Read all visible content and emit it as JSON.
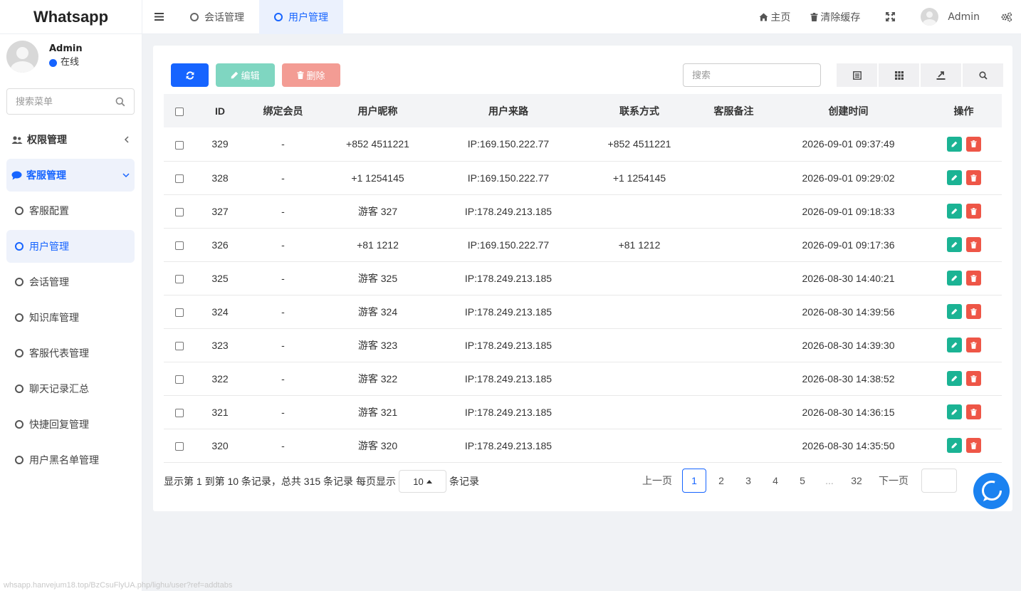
{
  "app": {
    "title": "Whatsapp"
  },
  "user": {
    "name": "Admin",
    "status": "在线"
  },
  "sidebar": {
    "search_placeholder": "搜索菜单",
    "groups": [
      {
        "label": "权限管理",
        "icon": "users-icon"
      },
      {
        "label": "客服管理",
        "icon": "comment-icon"
      }
    ],
    "items": [
      {
        "label": "客服配置"
      },
      {
        "label": "用户管理",
        "active": true
      },
      {
        "label": "会话管理"
      },
      {
        "label": "知识库管理"
      },
      {
        "label": "客服代表管理"
      },
      {
        "label": "聊天记录汇总"
      },
      {
        "label": "快捷回复管理"
      },
      {
        "label": "用户黑名单管理"
      }
    ]
  },
  "tabs": [
    {
      "label": "会话管理"
    },
    {
      "label": "用户管理",
      "active": true
    }
  ],
  "topbar": {
    "home": "主页",
    "clear_cache": "清除缓存",
    "user": "Admin"
  },
  "toolbar": {
    "edit": "编辑",
    "delete": "删除",
    "search_placeholder": "搜索"
  },
  "table": {
    "headers": [
      "ID",
      "绑定会员",
      "用户昵称",
      "用户来路",
      "联系方式",
      "客服备注",
      "创建时间",
      "操作"
    ],
    "rows": [
      {
        "id": "329",
        "member": "-",
        "nickname": "+852 4511221",
        "source": "IP:169.150.222.77",
        "contact": "+852 4511221",
        "note": "",
        "created": "2026-09-01 09:37:49"
      },
      {
        "id": "328",
        "member": "-",
        "nickname": "+1 1254145",
        "source": "IP:169.150.222.77",
        "contact": "+1 1254145",
        "note": "",
        "created": "2026-09-01 09:29:02"
      },
      {
        "id": "327",
        "member": "-",
        "nickname": "游客 327",
        "source": "IP:178.249.213.185",
        "contact": "",
        "note": "",
        "created": "2026-09-01 09:18:33"
      },
      {
        "id": "326",
        "member": "-",
        "nickname": "+81 1212",
        "source": "IP:169.150.222.77",
        "contact": "+81 1212",
        "note": "",
        "created": "2026-09-01 09:17:36"
      },
      {
        "id": "325",
        "member": "-",
        "nickname": "游客 325",
        "source": "IP:178.249.213.185",
        "contact": "",
        "note": "",
        "created": "2026-08-30 14:40:21"
      },
      {
        "id": "324",
        "member": "-",
        "nickname": "游客 324",
        "source": "IP:178.249.213.185",
        "contact": "",
        "note": "",
        "created": "2026-08-30 14:39:56"
      },
      {
        "id": "323",
        "member": "-",
        "nickname": "游客 323",
        "source": "IP:178.249.213.185",
        "contact": "",
        "note": "",
        "created": "2026-08-30 14:39:30"
      },
      {
        "id": "322",
        "member": "-",
        "nickname": "游客 322",
        "source": "IP:178.249.213.185",
        "contact": "",
        "note": "",
        "created": "2026-08-30 14:38:52"
      },
      {
        "id": "321",
        "member": "-",
        "nickname": "游客 321",
        "source": "IP:178.249.213.185",
        "contact": "",
        "note": "",
        "created": "2026-08-30 14:36:15"
      },
      {
        "id": "320",
        "member": "-",
        "nickname": "游客 320",
        "source": "IP:178.249.213.185",
        "contact": "",
        "note": "",
        "created": "2026-08-30 14:35:50"
      }
    ]
  },
  "pagination": {
    "info_prefix": "显示第 1 到第 10 条记录，总共 315 条记录 每页显示",
    "page_size": "10",
    "info_suffix": "条记录",
    "prev": "上一页",
    "next": "下一页",
    "pages": [
      "1",
      "2",
      "3",
      "4",
      "5",
      "...",
      "32"
    ],
    "current": "1"
  },
  "status_url": "whsapp.hanvejum18.top/BzCsuFlyUA.php/lighu/user?ref=addtabs",
  "colors": {
    "primary": "#1664ff",
    "success": "#1bb394",
    "danger": "#ee5647"
  }
}
